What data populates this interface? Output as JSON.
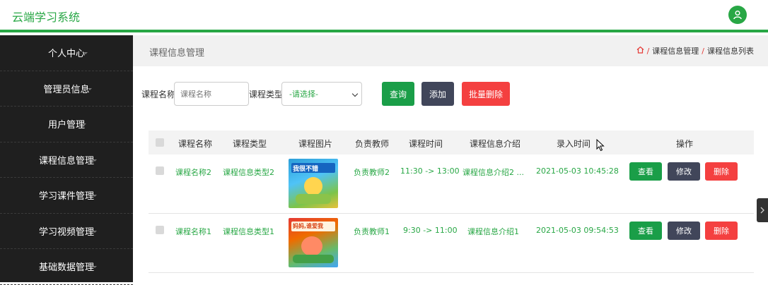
{
  "app": {
    "title": "云端学习系统"
  },
  "colors": {
    "accent": "#28a745",
    "sidebar": "#1f1f1f",
    "danger": "#f44040",
    "dark": "#41465a"
  },
  "sidebar": {
    "items": [
      {
        "label": "个人中心"
      },
      {
        "label": "管理员信息"
      },
      {
        "label": "用户管理"
      },
      {
        "label": "课程信息管理"
      },
      {
        "label": "学习课件管理"
      },
      {
        "label": "学习视频管理"
      },
      {
        "label": "基础数据管理"
      }
    ]
  },
  "page": {
    "title": "课程信息管理",
    "breadcrumb": [
      "课程信息管理",
      "课程信息列表"
    ],
    "breadcrumb_sep": "/"
  },
  "search": {
    "name_label": "课程名称",
    "name_placeholder": "课程名称",
    "type_label": "课程类型",
    "type_selected": "-请选择-",
    "query_label": "查询",
    "add_label": "添加",
    "batch_delete_label": "批量删除"
  },
  "table": {
    "headers": [
      "课程名称",
      "课程类型",
      "课程图片",
      "负责教师",
      "课程时间",
      "课程信息介绍",
      "录入时间",
      "操作"
    ],
    "rows": [
      {
        "name": "课程名称2",
        "type": "课程信息类型2",
        "teacher": "负责教师2",
        "time": "11:30 -> 13:00",
        "intro": "课程信息介绍2 ...",
        "created": "2021-05-03 10:45:28",
        "image_text": "我很不错"
      },
      {
        "name": "课程名称1",
        "type": "课程信息类型1",
        "teacher": "负责教师1",
        "time": "9:30 -> 11:00",
        "intro": "课程信息介绍1",
        "created": "2021-05-03 09:54:53",
        "image_text": "妈妈,谁爱我"
      }
    ],
    "actions": {
      "view": "查看",
      "edit": "修改",
      "delete": "删除"
    }
  }
}
